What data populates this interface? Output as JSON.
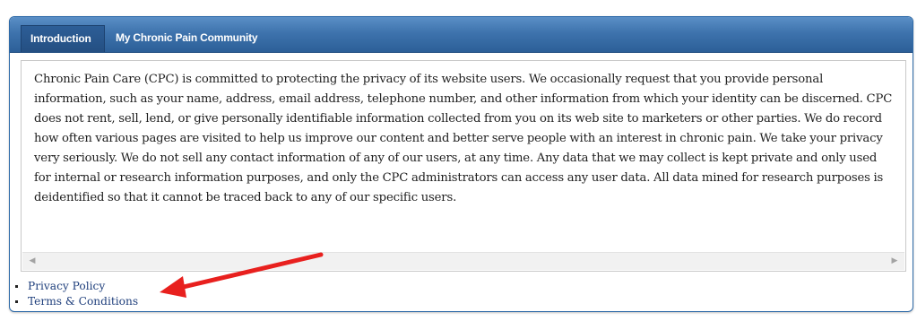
{
  "tabs": [
    {
      "label": "Introduction",
      "active": true
    },
    {
      "label": "My Chronic Pain Community",
      "active": false
    }
  ],
  "content": {
    "text": "Chronic Pain Care (CPC) is committed to protecting the privacy of its website users. We occasionally request that you provide personal information, such as your name, address, email address, telephone number, and other information from which your identity can be discerned. CPC does not rent, sell, lend, or give personally identifiable information collected from you on its web site to marketers or other parties. We do record how often various pages are visited to help us improve our content and better serve people with an interest in chronic pain. We take your privacy very seriously. We do not sell any contact information of any of our users, at any time. Any data that we may collect is kept private and only used for internal or research information purposes, and only the CPC administrators can access any user data. All data mined for research purposes is deidentified so that it cannot be traced back to any of our specific users."
  },
  "scrollbar": {
    "left_arrow": "◀",
    "right_arrow": "▶"
  },
  "links": [
    {
      "label": "Privacy Policy"
    },
    {
      "label": "Terms & Conditions"
    }
  ],
  "colors": {
    "tabbar": "#3e73ad",
    "link": "#1f3f7c",
    "annotation_arrow": "#e8201e"
  },
  "icons": {
    "annotation": "red-arrow-icon"
  }
}
